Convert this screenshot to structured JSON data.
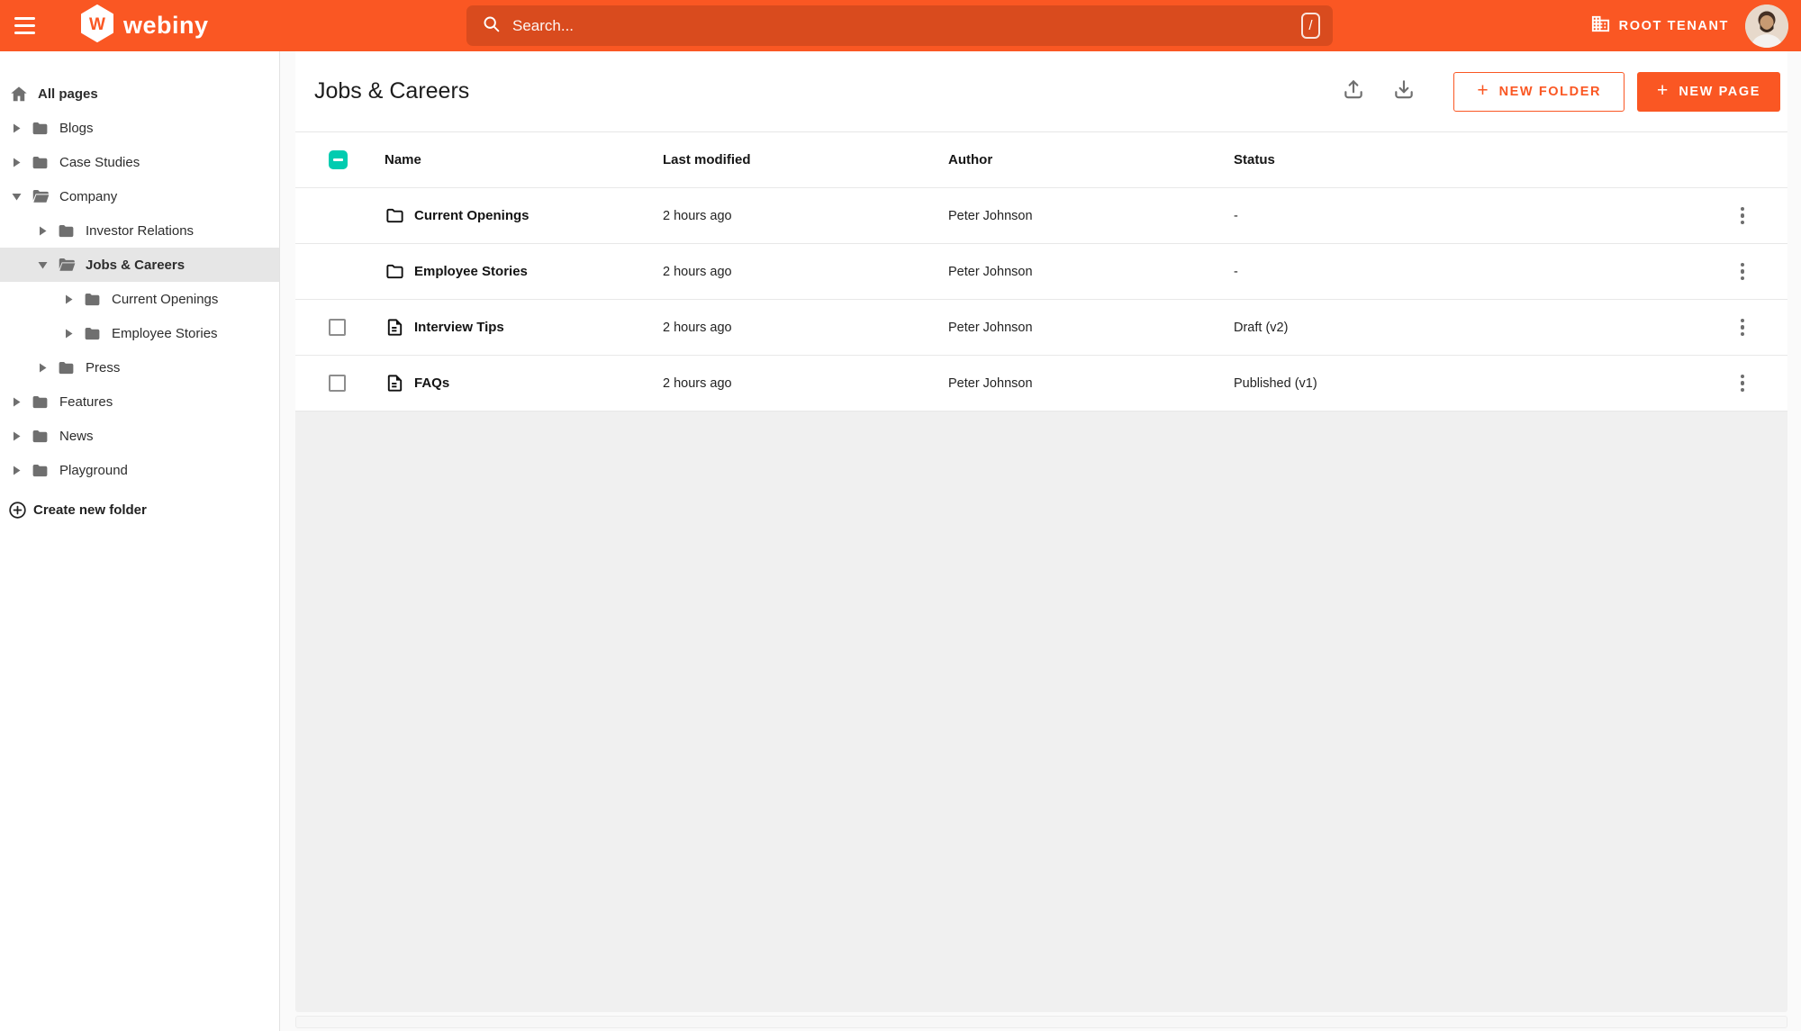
{
  "colors": {
    "primary": "#fa5723",
    "secondary_teal": "#00ccb0",
    "panel_bg": "#f0f0f0",
    "page_bg": "#fafafa",
    "selected_item_bg": "#e6e6e6"
  },
  "topbar": {
    "logo_letter": "W",
    "logo_text": "webiny",
    "search_placeholder": "Search...",
    "shortcut_hint": "/",
    "tenant_label": "ROOT TENANT"
  },
  "sidebar": {
    "items": [
      {
        "label": "All pages",
        "icon": "home-icon",
        "level": 0,
        "arrow": "none",
        "bold": true,
        "selected": false
      },
      {
        "label": "Blogs",
        "icon": "folder-closed-icon",
        "level": 0,
        "arrow": "right",
        "bold": false,
        "selected": false
      },
      {
        "label": "Case Studies",
        "icon": "folder-closed-icon",
        "level": 0,
        "arrow": "right",
        "bold": false,
        "selected": false
      },
      {
        "label": "Company",
        "icon": "folder-open-icon",
        "level": 0,
        "arrow": "down",
        "bold": false,
        "selected": false
      },
      {
        "label": "Investor Relations",
        "icon": "folder-closed-icon",
        "level": 1,
        "arrow": "right",
        "bold": false,
        "selected": false
      },
      {
        "label": "Jobs & Careers",
        "icon": "folder-open-icon",
        "level": 1,
        "arrow": "down",
        "bold": true,
        "selected": true
      },
      {
        "label": "Current Openings",
        "icon": "folder-closed-icon",
        "level": 2,
        "arrow": "right",
        "bold": false,
        "selected": false
      },
      {
        "label": "Employee Stories",
        "icon": "folder-closed-icon",
        "level": 2,
        "arrow": "right",
        "bold": false,
        "selected": false
      },
      {
        "label": "Press",
        "icon": "folder-closed-icon",
        "level": 1,
        "arrow": "right",
        "bold": false,
        "selected": false
      },
      {
        "label": "Features",
        "icon": "folder-closed-icon",
        "level": 0,
        "arrow": "right",
        "bold": false,
        "selected": false
      },
      {
        "label": "News",
        "icon": "folder-closed-icon",
        "level": 0,
        "arrow": "right",
        "bold": false,
        "selected": false
      },
      {
        "label": "Playground",
        "icon": "folder-closed-icon",
        "level": 0,
        "arrow": "right",
        "bold": false,
        "selected": false
      }
    ],
    "create_folder_label": "Create new folder"
  },
  "main": {
    "title": "Jobs & Careers",
    "toolbar": {
      "new_folder_label": "NEW FOLDER",
      "new_page_label": "NEW PAGE",
      "plus_glyph": "+"
    },
    "table": {
      "headers": [
        "Name",
        "Last modified",
        "Author",
        "Status"
      ],
      "header_checkbox_state": "indeterminate",
      "rows": [
        {
          "name": "Current Openings",
          "icon": "folder-outline-icon",
          "checkbox": "hidden",
          "modified": "2 hours ago",
          "author": "Peter Johnson",
          "status": "-"
        },
        {
          "name": "Employee Stories",
          "icon": "folder-outline-icon",
          "checkbox": "hidden",
          "modified": "2 hours ago",
          "author": "Peter Johnson",
          "status": "-"
        },
        {
          "name": "Interview Tips",
          "icon": "document-icon",
          "checkbox": "unchecked",
          "modified": "2 hours ago",
          "author": "Peter Johnson",
          "status": "Draft (v2)"
        },
        {
          "name": "FAQs",
          "icon": "document-icon",
          "checkbox": "unchecked",
          "modified": "2 hours ago",
          "author": "Peter Johnson",
          "status": "Published (v1)"
        }
      ]
    }
  }
}
